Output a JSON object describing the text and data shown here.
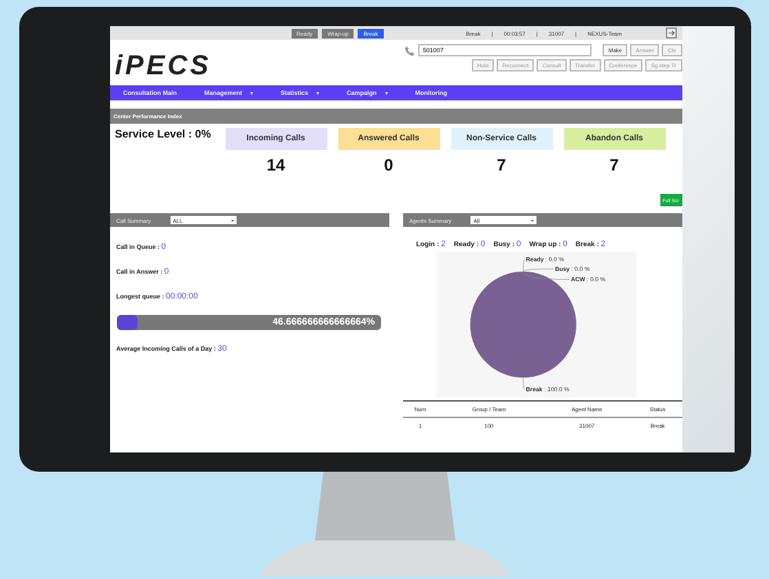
{
  "agent_bar": {
    "state_buttons": [
      {
        "label": "Ready",
        "selected": false
      },
      {
        "label": "Wrap-up",
        "selected": false
      },
      {
        "label": "Break",
        "selected": true
      }
    ],
    "info": [
      "Break",
      "|",
      "00:03:57",
      "|",
      "31007",
      "|",
      "NEXUS-Team"
    ]
  },
  "header": {
    "logo": "iPECS",
    "dial_field": {
      "value": "501007"
    },
    "call_buttons": [
      {
        "label": "Make",
        "disabled": false
      },
      {
        "label": "Answer",
        "disabled": true
      },
      {
        "label": "Cle",
        "disabled": true
      }
    ],
    "action_buttons": [
      "Hold",
      "Reconnect",
      "Consult",
      "Transfer",
      "Conference",
      "Sg.step Tr"
    ]
  },
  "nav": [
    {
      "label": "Consultation Main",
      "dropdown": false
    },
    {
      "label": "Management",
      "dropdown": true
    },
    {
      "label": "Statistics",
      "dropdown": true
    },
    {
      "label": "Campaign",
      "dropdown": true
    },
    {
      "label": "Monitoring",
      "dropdown": false
    }
  ],
  "performance": {
    "title": "Center Performance Index",
    "service_level": "Service Level : 0%",
    "cards": [
      {
        "label": "Incoming Calls",
        "value": "14",
        "color": "#e3defa"
      },
      {
        "label": "Answered Calls",
        "value": "0",
        "color": "#fbdf94"
      },
      {
        "label": "Non-Service Calls",
        "value": "7",
        "color": "#dff1fb"
      },
      {
        "label": "Abandon Calls",
        "value": "7",
        "color": "#d7ee9f"
      }
    ],
    "full_screen_button": "Full Scr"
  },
  "call_summary": {
    "title": "Call Summary",
    "filter": "ALL",
    "stats": [
      {
        "label": "Call in Queue : ",
        "value": "0"
      },
      {
        "label": "Call in Answer : ",
        "value": "0"
      },
      {
        "label": "Longest queue : ",
        "value": "00:00:00"
      }
    ],
    "progress": {
      "level": 0.0467,
      "reading": "46.666666666666664%"
    },
    "average": {
      "label": "Average Incoming Calls of a Day : ",
      "value": "30"
    }
  },
  "agents_summary": {
    "title": "Agents Summary",
    "filter": "All",
    "counts": [
      {
        "label": "Login : ",
        "value": "2"
      },
      {
        "label": "Ready : ",
        "value": "0"
      },
      {
        "label": "Busy : ",
        "value": "0"
      },
      {
        "label": "Wrap up : ",
        "value": "0"
      },
      {
        "label": "Break : ",
        "value": "2"
      }
    ],
    "chart_data": {
      "type": "pie",
      "categories": [
        "Ready",
        "Busy",
        "ACW",
        "Break"
      ],
      "values": [
        0,
        0,
        0,
        100
      ],
      "value_labels": [
        ": 0.0 %",
        ": 0.0 %",
        ": 0.0 %",
        ": 100.0 %"
      ]
    },
    "table": {
      "columns": [
        "Num",
        "Group / Team",
        "Agent Name",
        "Status"
      ],
      "rows": [
        [
          "1",
          "100",
          "31007",
          "Break"
        ]
      ]
    }
  }
}
